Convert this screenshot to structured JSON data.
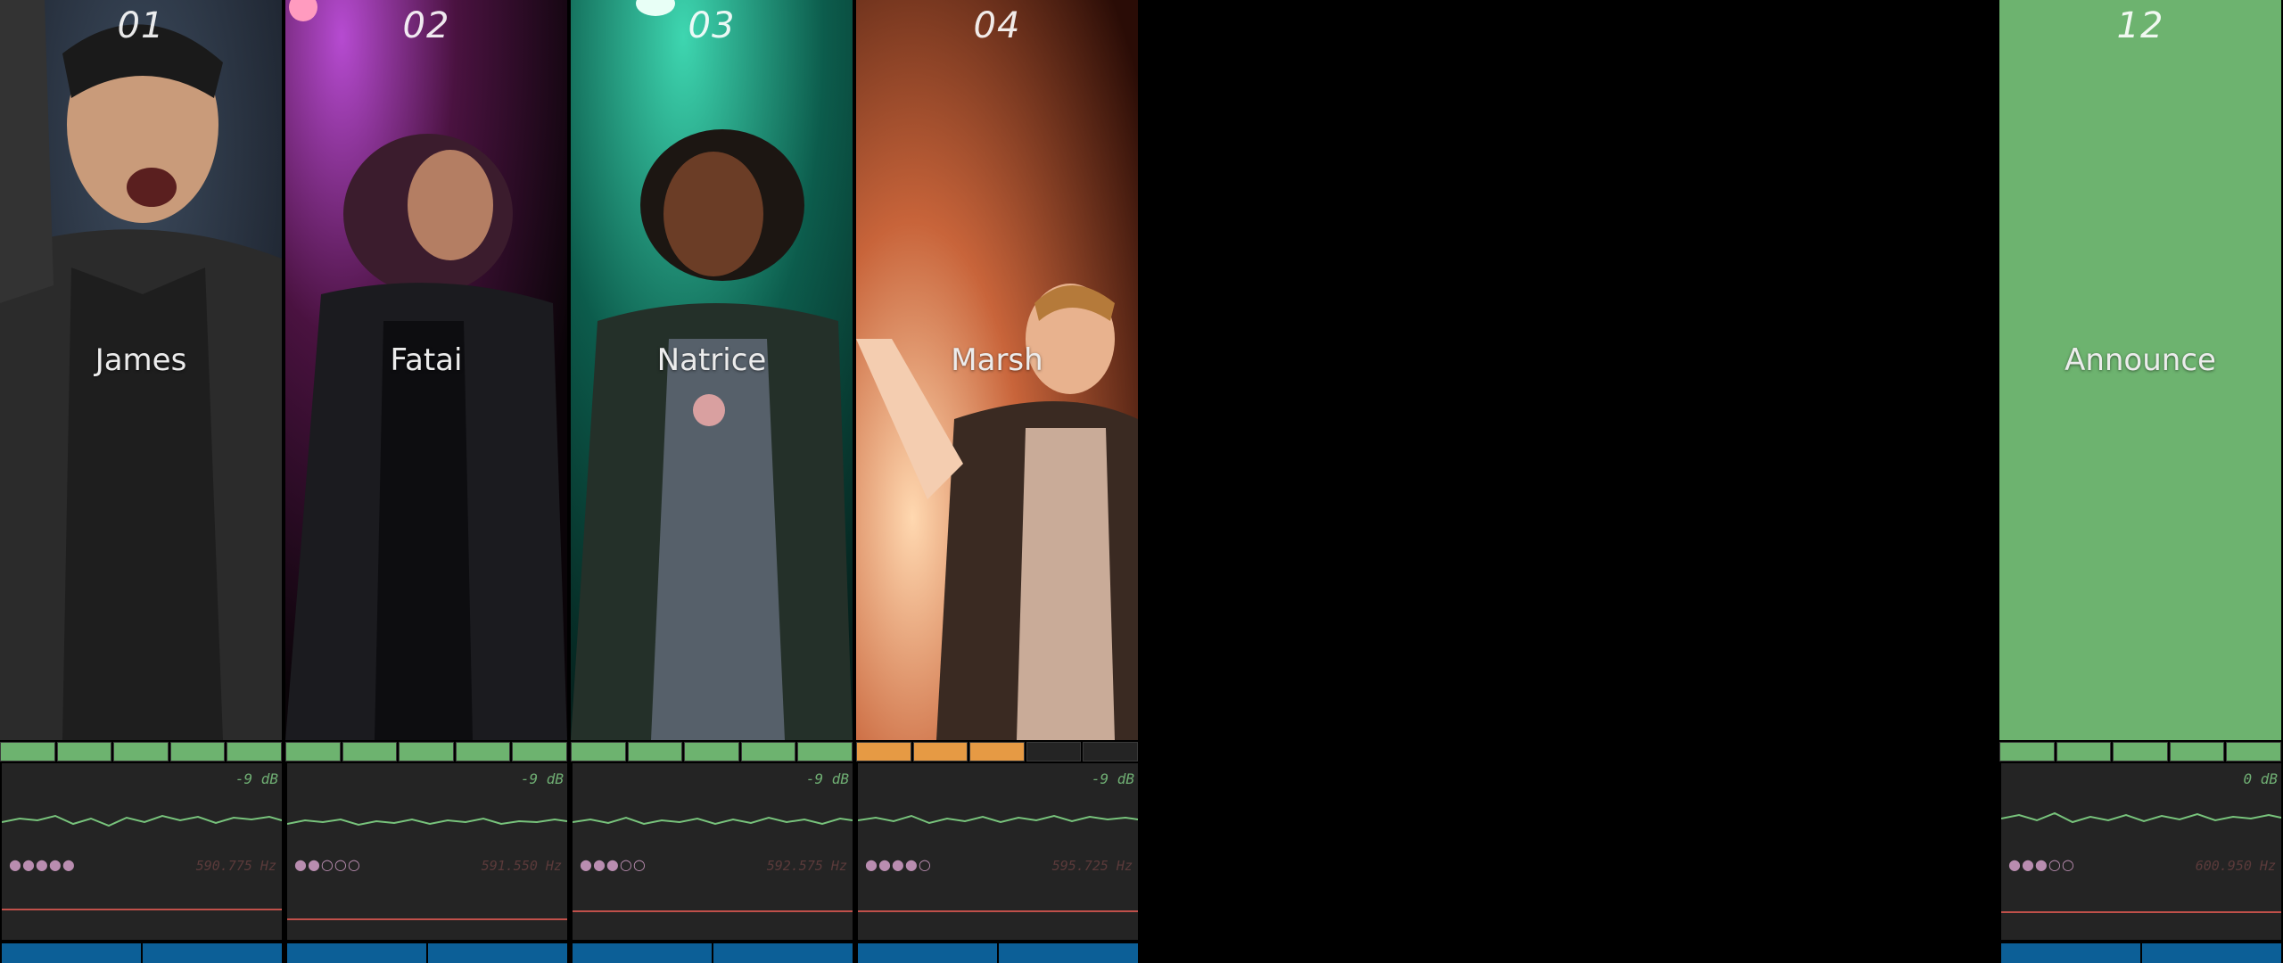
{
  "colors": {
    "meter_green": "#6db36f",
    "meter_orange": "#e69a44",
    "meter_empty": "#242424",
    "panel_bg": "#242424",
    "wave": "#78c47c",
    "bar_blue": "#0c5f97",
    "redline": "#c0504a"
  },
  "channels": [
    {
      "number": "01",
      "name": "James",
      "db": "-9 dB",
      "hz": "590.775 Hz",
      "dots": "●●●●●",
      "meter_level": 5,
      "meter_color": "green"
    },
    {
      "number": "02",
      "name": "Fatai",
      "db": "-9 dB",
      "hz": "591.550 Hz",
      "dots": "●●○○○",
      "meter_level": 5,
      "meter_color": "green"
    },
    {
      "number": "03",
      "name": "Natrice",
      "db": "-9 dB",
      "hz": "592.575 Hz",
      "dots": "●●●○○",
      "meter_level": 5,
      "meter_color": "green"
    },
    {
      "number": "04",
      "name": "Marsh",
      "db": "-9 dB",
      "hz": "595.725 Hz",
      "dots": "●●●●○",
      "meter_level": 3,
      "meter_color": "orange"
    },
    {
      "number": "12",
      "name": "Announce",
      "db": "0 dB",
      "hz": "600.950 Hz",
      "dots": "●●●○○",
      "meter_level": 5,
      "meter_color": "green"
    }
  ]
}
